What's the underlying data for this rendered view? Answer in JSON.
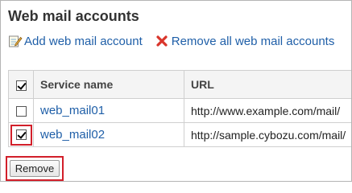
{
  "page": {
    "title": "Web mail accounts"
  },
  "menu": {
    "add_label": "Add web mail account",
    "remove_all_label": "Remove all web mail accounts"
  },
  "table": {
    "headers": {
      "service": "Service name",
      "url": "URL"
    },
    "rows": [
      {
        "name": "web_mail01",
        "url": "http://www.example.com/mail/",
        "checked": false
      },
      {
        "name": "web_mail02",
        "url": "http://sample.cybozu.com/mail/",
        "checked": true
      }
    ]
  },
  "actions": {
    "remove_label": "Remove"
  },
  "colors": {
    "link": "#1f5fa8",
    "highlight": "#d21f2a",
    "remove_icon": "#d9352b"
  },
  "icons": {
    "add": "notepad-pencil-icon",
    "remove_all": "red-x-icon"
  }
}
